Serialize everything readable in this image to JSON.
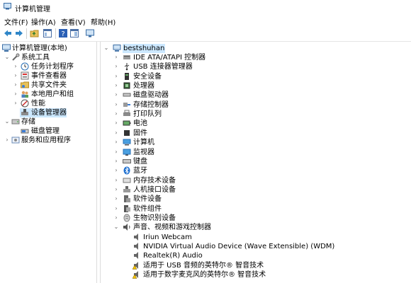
{
  "window": {
    "title": "计算机管理"
  },
  "menu": [
    "文件(F)",
    "操作(A)",
    "查看(V)",
    "帮助(H)"
  ],
  "toolbar": [
    "back-icon",
    "forward-icon",
    "up-folder-icon",
    "properties-icon",
    "help-icon",
    "show-hide-icon",
    "monitor-icon"
  ],
  "left_tree": [
    {
      "label": "计算机管理(本地)",
      "icon": "computer-management-icon"
    },
    {
      "label": "系统工具",
      "icon": "tools-icon"
    },
    {
      "label": "任务计划程序",
      "icon": "clock-icon"
    },
    {
      "label": "事件查看器",
      "icon": "event-viewer-icon"
    },
    {
      "label": "共享文件夹",
      "icon": "shared-folder-icon"
    },
    {
      "label": "本地用户和组",
      "icon": "users-icon"
    },
    {
      "label": "性能",
      "icon": "performance-icon"
    },
    {
      "label": "设备管理器",
      "icon": "device-manager-icon"
    },
    {
      "label": "存储",
      "icon": "storage-icon"
    },
    {
      "label": "磁盘管理",
      "icon": "disk-management-icon"
    },
    {
      "label": "服务和应用程序",
      "icon": "services-icon"
    }
  ],
  "device_tree": {
    "root": "bestshuhan",
    "categories": [
      {
        "label": "IDE ATA/ATAPI 控制器",
        "icon": "ide-controller-icon"
      },
      {
        "label": "USB 连接器管理器",
        "icon": "usb-connector-icon"
      },
      {
        "label": "安全设备",
        "icon": "security-device-icon"
      },
      {
        "label": "处理器",
        "icon": "processor-icon"
      },
      {
        "label": "磁盘驱动器",
        "icon": "disk-drive-icon"
      },
      {
        "label": "存储控制器",
        "icon": "storage-controller-icon"
      },
      {
        "label": "打印队列",
        "icon": "printer-icon"
      },
      {
        "label": "电池",
        "icon": "battery-icon"
      },
      {
        "label": "固件",
        "icon": "firmware-icon"
      },
      {
        "label": "计算机",
        "icon": "computer-icon"
      },
      {
        "label": "监视器",
        "icon": "monitor-icon"
      },
      {
        "label": "键盘",
        "icon": "keyboard-icon"
      },
      {
        "label": "蓝牙",
        "icon": "bluetooth-icon"
      },
      {
        "label": "内存技术设备",
        "icon": "memory-icon"
      },
      {
        "label": "人机接口设备",
        "icon": "hid-icon"
      },
      {
        "label": "软件设备",
        "icon": "software-device-icon"
      },
      {
        "label": "软件组件",
        "icon": "software-component-icon"
      },
      {
        "label": "生物识别设备",
        "icon": "biometric-icon"
      },
      {
        "label": "声音、视频和游戏控制器",
        "icon": "sound-icon"
      }
    ],
    "sound_children": [
      {
        "label": "Iriun Webcam",
        "icon": "speaker-icon"
      },
      {
        "label": "NVIDIA Virtual Audio Device (Wave Extensible) (WDM)",
        "icon": "speaker-icon"
      },
      {
        "label": "Realtek(R) Audio",
        "icon": "speaker-icon"
      },
      {
        "label": "适用于 USB 音频的英特尔® 智音技术",
        "icon": "speaker-warning-icon"
      },
      {
        "label": "适用于数字麦克风的英特尔® 智音技术",
        "icon": "speaker-warning-icon"
      }
    ]
  }
}
